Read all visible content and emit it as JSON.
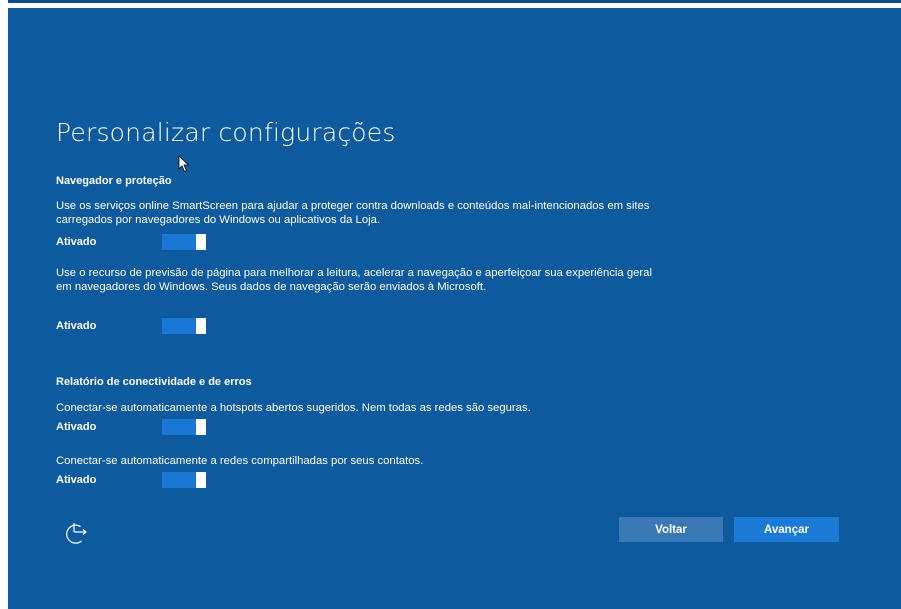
{
  "title": "Personalizar configurações",
  "sections": [
    {
      "heading": "Navegador e proteção",
      "settings": [
        {
          "description": "Use os serviços online SmartScreen para ajudar a proteger contra downloads e conteúdos mal-intencionados em sites carregados por navegadores do Windows ou aplicativos da Loja.",
          "state": "Ativado",
          "on": true
        },
        {
          "description": "Use o recurso de previsão de página para melhorar a leitura, acelerar a navegação e aperfeiçoar sua experiência geral em navegadores do Windows. Seus dados de navegação serão enviados à Microsoft.",
          "state": "Ativado",
          "on": true
        }
      ]
    },
    {
      "heading": "Relatório de conectividade e de erros",
      "settings": [
        {
          "description": "Conectar-se automaticamente a hotspots abertos sugeridos. Nem todas as redes são seguras.",
          "state": "Ativado",
          "on": true
        },
        {
          "description": "Conectar-se automaticamente a redes compartilhadas por seus contatos.",
          "state": "Ativado",
          "on": true
        }
      ]
    }
  ],
  "buttons": {
    "back": "Voltar",
    "next": "Avançar"
  },
  "icons": {
    "accessibility": "ease-of-access-icon",
    "cursor": "mouse-pointer-icon"
  },
  "colors": {
    "background": "#0d5a9f",
    "toggle_on": "#1976d4",
    "back_button": "#3978b5",
    "next_button": "#1a7ad6"
  }
}
